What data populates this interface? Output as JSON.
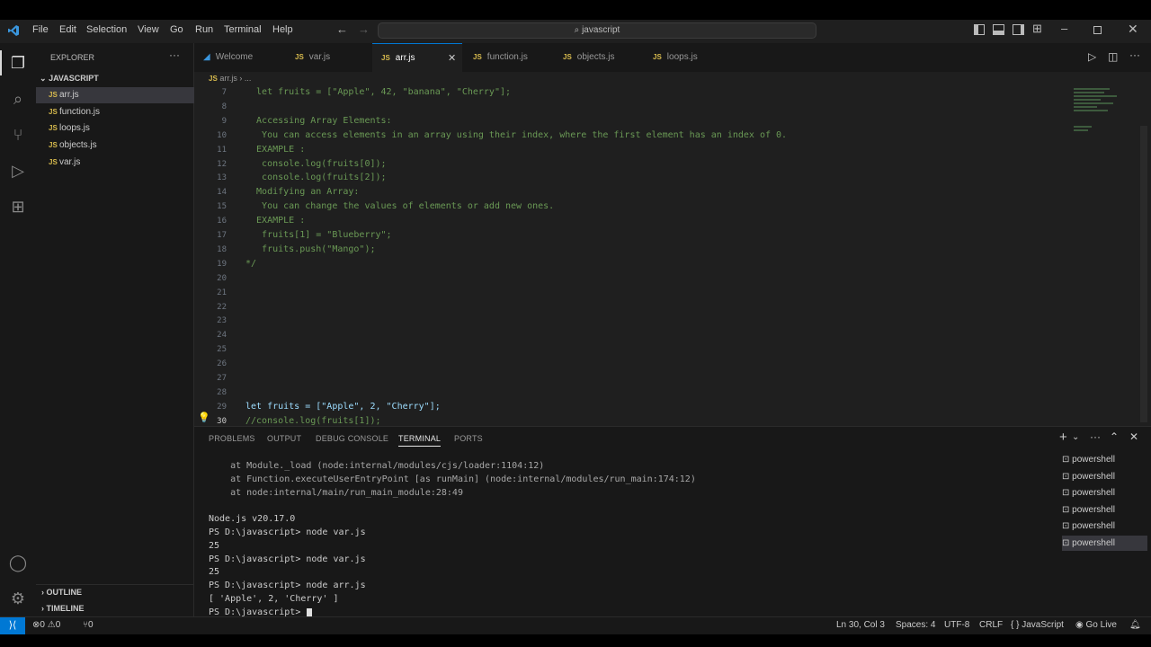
{
  "titlebar": {
    "menu": [
      "File",
      "Edit",
      "Selection",
      "View",
      "Go",
      "Run",
      "Terminal",
      "Help"
    ],
    "search": "javascript"
  },
  "sidebar": {
    "header": "EXPLORER",
    "folder": "JAVASCRIPT",
    "files": [
      "arr.js",
      "function.js",
      "loops.js",
      "objects.js",
      "var.js"
    ],
    "outline": "OUTLINE",
    "timeline": "TIMELINE"
  },
  "tabs": [
    {
      "label": "Welcome",
      "active": false
    },
    {
      "label": "var.js",
      "active": false
    },
    {
      "label": "arr.js",
      "active": true
    },
    {
      "label": "function.js",
      "active": false
    },
    {
      "label": "objects.js",
      "active": false
    },
    {
      "label": "loops.js",
      "active": false
    }
  ],
  "breadcrumb": {
    "file": "arr.js",
    "more": "..."
  },
  "editor": {
    "lines": [
      {
        "n": "7",
        "text": "  let fruits = [\"Apple\", 42, \"banana\", \"Cherry\"];"
      },
      {
        "n": "8",
        "text": ""
      },
      {
        "n": "9",
        "text": "  Accessing Array Elements:"
      },
      {
        "n": "10",
        "text": "   You can access elements in an array using their index, where the first element has an index of 0."
      },
      {
        "n": "11",
        "text": "  EXAMPLE :"
      },
      {
        "n": "12",
        "text": "   console.log(fruits[0]);"
      },
      {
        "n": "13",
        "text": "   console.log(fruits[2]);"
      },
      {
        "n": "14",
        "text": "  Modifying an Array:"
      },
      {
        "n": "15",
        "text": "   You can change the values of elements or add new ones."
      },
      {
        "n": "16",
        "text": "  EXAMPLE :"
      },
      {
        "n": "17",
        "text": "   fruits[1] = \"Blueberry\";"
      },
      {
        "n": "18",
        "text": "   fruits.push(\"Mango\");"
      },
      {
        "n": "19",
        "text": "*/"
      },
      {
        "n": "20",
        "text": ""
      },
      {
        "n": "21",
        "text": ""
      },
      {
        "n": "22",
        "text": ""
      },
      {
        "n": "23",
        "text": ""
      },
      {
        "n": "24",
        "text": ""
      },
      {
        "n": "25",
        "text": ""
      },
      {
        "n": "26",
        "text": ""
      },
      {
        "n": "27",
        "text": ""
      },
      {
        "n": "28",
        "text": ""
      },
      {
        "n": "29",
        "text": "let fruits = [\"Apple\", 2, \"Cherry\"];"
      },
      {
        "n": "30",
        "text": "//console.log(fruits[1]);"
      }
    ]
  },
  "panel": {
    "tabs": [
      "PROBLEMS",
      "OUTPUT",
      "DEBUG CONSOLE",
      "TERMINAL",
      "PORTS"
    ],
    "active_tab": "TERMINAL",
    "terminal_lines": [
      "    at Module._load (node:internal/modules/cjs/loader:1104:12)",
      "    at Function.executeUserEntryPoint [as runMain] (node:internal/modules/run_main:174:12)",
      "    at node:internal/main/run_main_module:28:49",
      "",
      "Node.js v20.17.0",
      "PS D:\\javascript> node var.js",
      "25",
      "PS D:\\javascript> node var.js",
      "25",
      "PS D:\\javascript> node arr.js",
      "[ 'Apple', 2, 'Cherry' ]",
      "PS D:\\javascript> "
    ],
    "shells": [
      "powershell",
      "powershell",
      "powershell",
      "powershell",
      "powershell",
      "powershell"
    ]
  },
  "statusbar": {
    "errors": "0",
    "warnings": "0",
    "ports": "0",
    "position": "Ln 30, Col 3",
    "spaces": "Spaces: 4",
    "encoding": "UTF-8",
    "eol": "CRLF",
    "language": "JavaScript",
    "golive": "Go Live"
  }
}
